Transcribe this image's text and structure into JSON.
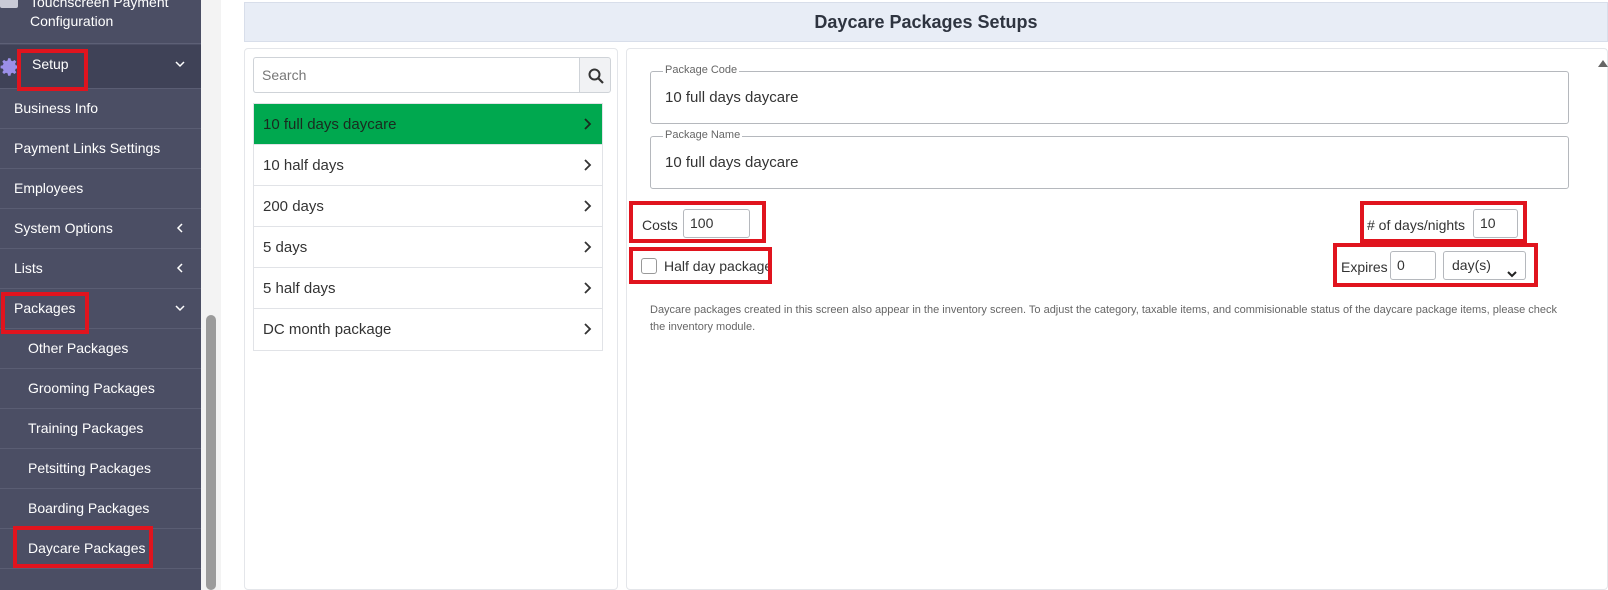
{
  "sidebar": {
    "top_item": {
      "line1": "Touchscreen Payment",
      "line2": "Configuration"
    },
    "setup": {
      "label": "Setup"
    },
    "items": [
      {
        "label": "Business Info"
      },
      {
        "label": "Payment Links Settings"
      },
      {
        "label": "Employees"
      },
      {
        "label": "System Options"
      },
      {
        "label": "Lists"
      },
      {
        "label": "Packages"
      }
    ],
    "sub_items": [
      {
        "label": "Other Packages"
      },
      {
        "label": "Grooming Packages"
      },
      {
        "label": "Training Packages"
      },
      {
        "label": "Petsitting Packages"
      },
      {
        "label": "Boarding Packages"
      },
      {
        "label": "Daycare Packages"
      }
    ]
  },
  "header": {
    "title": "Daycare Packages Setups"
  },
  "search": {
    "placeholder": "Search"
  },
  "packages": [
    {
      "label": "10 full days daycare"
    },
    {
      "label": "10 half days"
    },
    {
      "label": "200 days"
    },
    {
      "label": "5 days"
    },
    {
      "label": "5 half days"
    },
    {
      "label": "DC month package"
    }
  ],
  "form": {
    "package_code": {
      "legend": "Package Code",
      "value": "10 full days daycare"
    },
    "package_name": {
      "legend": "Package Name",
      "value": "10 full days daycare"
    },
    "costs": {
      "label": "Costs",
      "value": "100"
    },
    "days_nights": {
      "label": "# of days/nights",
      "value": "10"
    },
    "half_day": {
      "label": "Half day package"
    },
    "expires": {
      "label": "Expires",
      "value": "0",
      "unit": "day(s)"
    },
    "note": "Daycare packages created in this screen also appear in the inventory screen. To adjust the category, taxable items, and commisionable status of the daycare package items, please check the inventory module."
  },
  "colors": {
    "sidebar": "#4b4e64",
    "active_item": "#00a84f",
    "highlight": "#e0141e",
    "header_bg": "#e8edf6"
  },
  "icons": {
    "setup": "gear-icon",
    "search": "search-icon",
    "chevron": "chevron-right-icon",
    "expand": "chevron-down-icon",
    "collapse": "chevron-left-icon"
  }
}
